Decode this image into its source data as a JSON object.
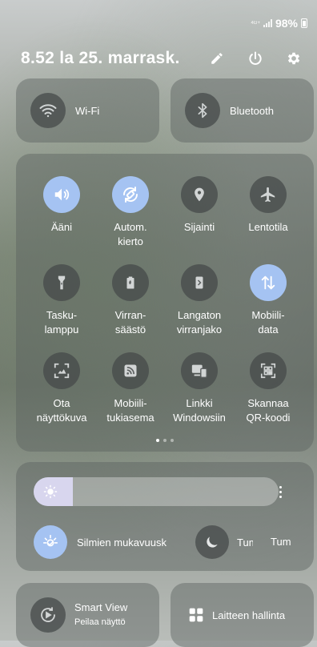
{
  "status": {
    "network": "4G+",
    "battery": "98%"
  },
  "header": {
    "datetime": "8.52  la 25. marrask.",
    "icons": [
      "edit-icon",
      "power-icon",
      "settings-icon"
    ]
  },
  "top_toggles": [
    {
      "label": "Wi-Fi",
      "icon": "wifi-icon",
      "active": false
    },
    {
      "label": "Bluetooth",
      "icon": "bluetooth-icon",
      "active": false
    }
  ],
  "grid": {
    "tiles": [
      {
        "label": "Ääni",
        "icon": "sound-icon",
        "active": true
      },
      {
        "label": "Autom.\nkierto",
        "icon": "auto-rotate-icon",
        "active": true
      },
      {
        "label": "Sijainti",
        "icon": "location-icon",
        "active": false
      },
      {
        "label": "Lentotila",
        "icon": "airplane-icon",
        "active": false
      },
      {
        "label": "Tasku-\nlamppu",
        "icon": "flashlight-icon",
        "active": false
      },
      {
        "label": "Virran-\nsäästö",
        "icon": "power-saving-icon",
        "active": false
      },
      {
        "label": "Langaton\nvirranjako",
        "icon": "wireless-power-share-icon",
        "active": false
      },
      {
        "label": "Mobiili-\ndata",
        "icon": "mobile-data-icon",
        "active": true
      },
      {
        "label": "Ota\nnäyttökuva",
        "icon": "screenshot-icon",
        "active": false
      },
      {
        "label": "Mobiili-\ntukiasema",
        "icon": "hotspot-icon",
        "active": false
      },
      {
        "label": "Linkki\nWindowsiin",
        "icon": "link-to-windows-icon",
        "active": false
      },
      {
        "label": "Skannaa\nQR-koodi",
        "icon": "qr-scan-icon",
        "active": false
      }
    ],
    "page_count": 3,
    "active_page": 1
  },
  "brightness": {
    "level": 0.16,
    "eye_comfort_label": "Silmien mukavuusk",
    "dark_mode_label": "Tumma tila",
    "next_label": "Tum"
  },
  "bottom": {
    "smart_view_title": "Smart View",
    "smart_view_subtitle": "Peilaa näyttö",
    "device_control_label": "Laitteen hallinta"
  },
  "colors": {
    "active": "#a5c3f2",
    "inactive": "#464a4a"
  }
}
